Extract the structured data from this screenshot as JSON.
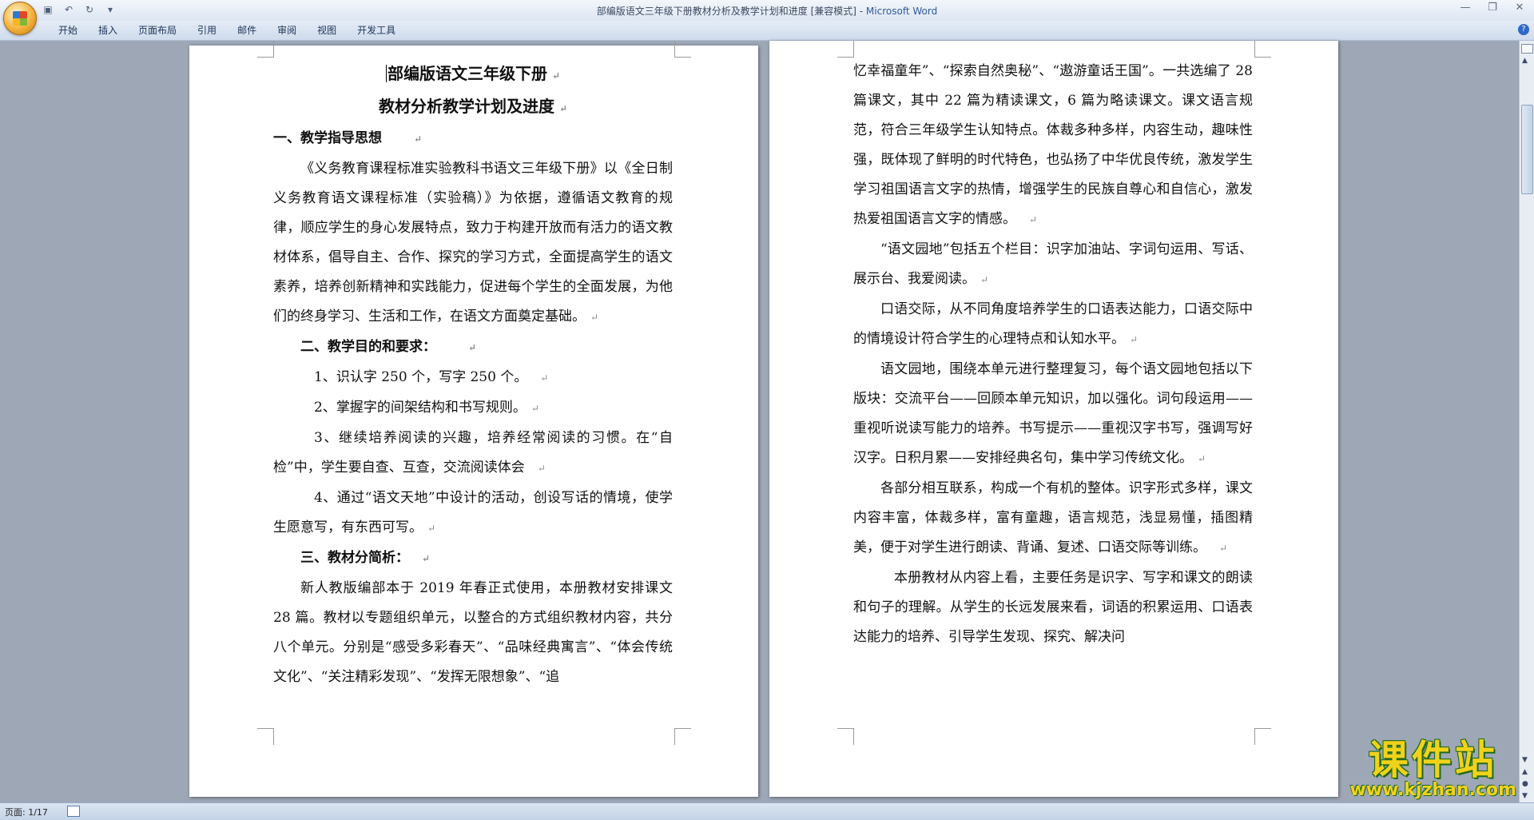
{
  "window": {
    "title": "部编版语文三年级下册教材分析及教学计划和进度 [兼容模式] - ",
    "app_name": "Microsoft Word"
  },
  "quick_access": {
    "save_icon": "save-icon",
    "undo_icon": "undo-icon",
    "redo_icon": "redo-icon",
    "customize_icon": "dropdown-icon"
  },
  "ribbon": {
    "tabs": [
      "开始",
      "插入",
      "页面布局",
      "引用",
      "邮件",
      "审阅",
      "视图",
      "开发工具"
    ]
  },
  "pages": {
    "page1": [
      "部编版语文三年级下册",
      "教材分析教学计划及进度",
      "一、教学指导思想",
      "《义务教育课程标准实验教科书语文三年级下册》以《全日制义务教育语文课程标准（实验稿）》为依据，遵循语文教育的规律，顺应学生的身心发展特点，致力于构建开放而有活力的语文教材体系，倡导自主、合作、探究的学习方式，全面提高学生的语文素养，培养创新精神和实践能力，促进每个学生的全面发展，为他们的终身学习、生活和工作，在语文方面奠定基础。",
      "二、教学目的和要求：",
      "1、识认字 250 个，写字 250 个。",
      "2、掌握字的间架结构和书写规则。",
      "3、继续培养阅读的兴趣，培养经常阅读的习惯。在“自检”中，学生要自查、互查，交流阅读体会",
      "4、通过“语文天地”中设计的活动，创设写话的情境，使学生愿意写，有东西可写。",
      "三、教材分简析：",
      "新人教版编部本于 2019 年春正式使用，本册教材安排课文 28 篇。教材以专题组织单元，以整合的方式组织教材内容，共分八个单元。分别是“感受多彩春天”、“品味经典寓言”、“体会传统文化”、“关注精彩发现”、“发挥无限想象”、“追"
    ],
    "page2": [
      "忆幸福童年”、“探索自然奥秘”、“遨游童话王国”。一共选编了 28 篇课文，其中 22 篇为精读课文，6 篇为略读课文。课文语言规范，符合三年级学生认知特点。体裁多种多样，内容生动，趣味性强，既体现了鲜明的时代特色，也弘扬了中华优良传统，激发学生学习祖国语言文字的热情，增强学生的民族自尊心和自信心，激发热爱祖国语言文字的情感。",
      "“语文园地”包括五个栏目：识字加油站、字词句运用、写话、展示台、我爱阅读。",
      "口语交际，从不同角度培养学生的口语表达能力，口语交际中的情境设计符合学生的心理特点和认知水平。",
      "语文园地，围绕本单元进行整理复习，每个语文园地包括以下版块：交流平台——回顾本单元知识，加以强化。词句段运用——重视听说读写能力的培养。书写提示——重视汉字书写，强调写好汉字。日积月累——安排经典名句，集中学习传统文化。",
      "各部分相互联系，构成一个有机的整体。识字形式多样，课文内容丰富，体裁多样，富有童趣，语言规范，浅显易懂，插图精美，便于对学生进行朗读、背诵、复述、口语交际等训练。",
      "本册教材从内容上看，主要任务是识字、写字和课文的朗读和句子的理解。从学生的长远发展来看，词语的积累运用、口语表达能力的培养、引导学生发现、探究、解决问"
    ]
  },
  "paragraph_mark": "↵",
  "status": {
    "page_info": "页面: 1/17"
  },
  "watermark": {
    "main": "课件站",
    "url": "www.kjzhan.com"
  }
}
